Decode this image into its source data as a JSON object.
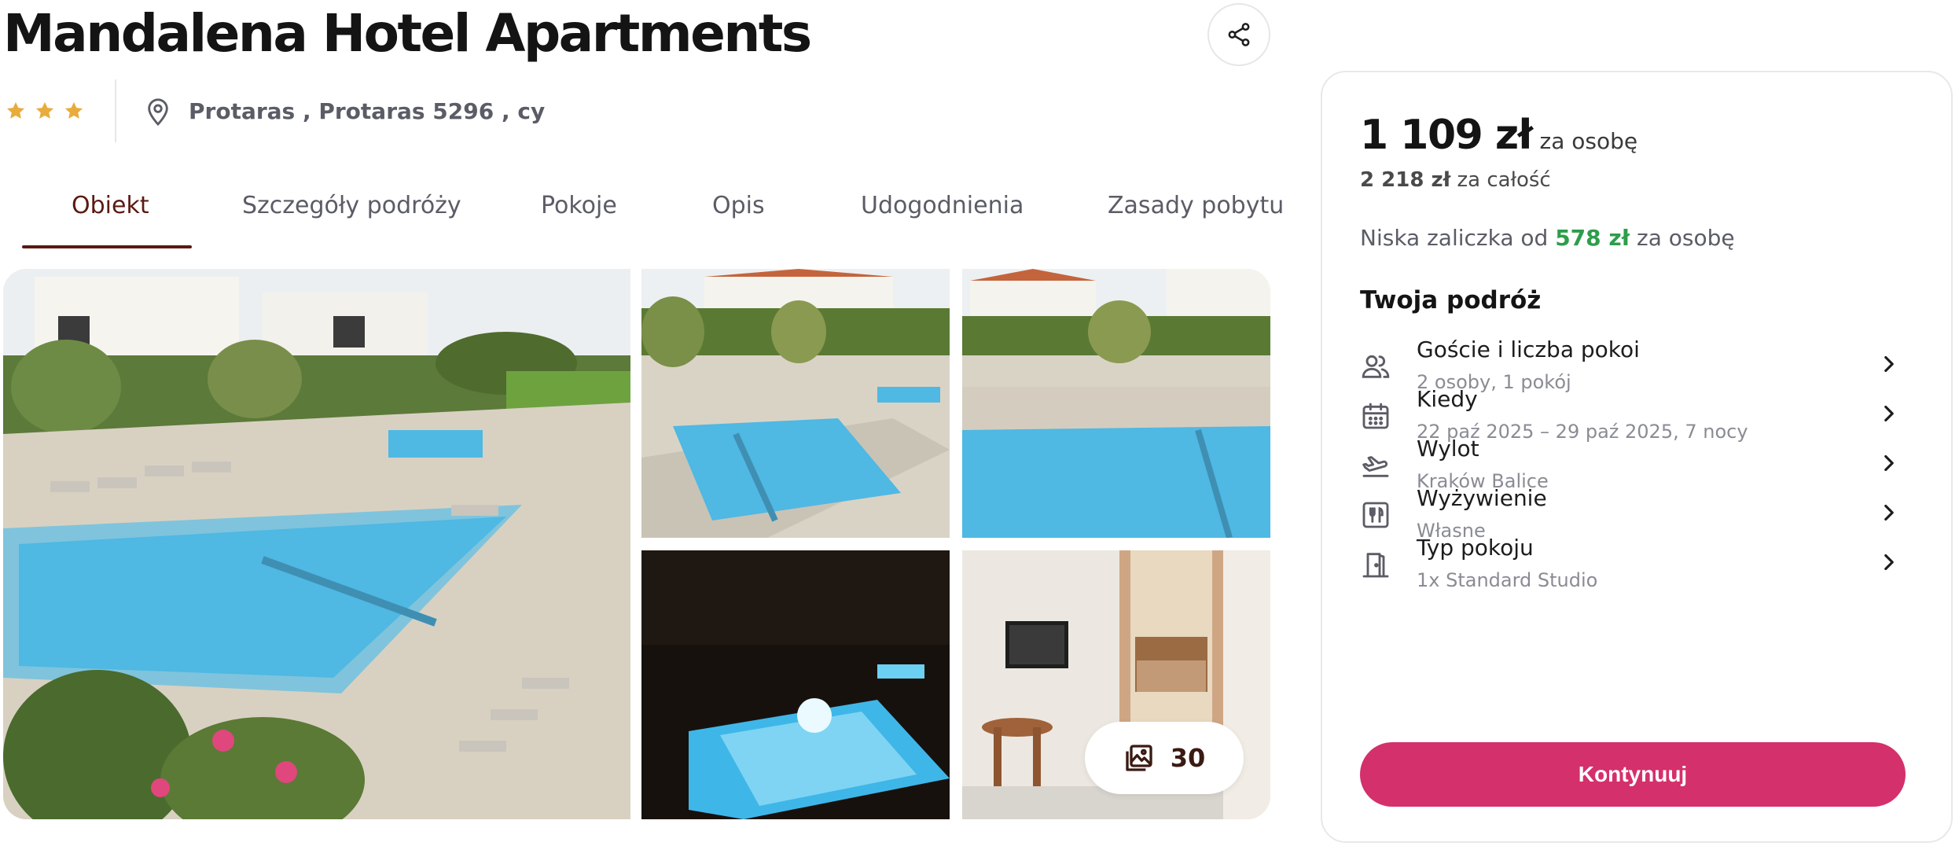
{
  "hotel": {
    "name": "Mandalena Hotel Apartments",
    "stars": 3,
    "location": "Protaras , Protaras 5296 , cy"
  },
  "tabs": [
    {
      "label": "Obiekt",
      "active": true
    },
    {
      "label": "Szczegóły podróży",
      "active": false
    },
    {
      "label": "Pokoje",
      "active": false
    },
    {
      "label": "Opis",
      "active": false
    },
    {
      "label": "Udogodnienia",
      "active": false
    },
    {
      "label": "Zasady pobytu",
      "active": false
    }
  ],
  "gallery": {
    "photo_count": "30"
  },
  "booking": {
    "price": "1 109 zł",
    "price_unit": "za osobę",
    "total_price": "2 218 zł",
    "total_unit": "za całość",
    "deposit_prefix": "Niska zaliczka od",
    "deposit_amount": "578 zł",
    "deposit_unit": "za osobę",
    "trip_heading": "Twoja podróż",
    "rows": [
      {
        "title": "Goście i liczba pokoi",
        "value": "2 osoby, 1 pokój",
        "icon": "guests-icon"
      },
      {
        "title": "Kiedy",
        "value": "22 paź 2025 – 29 paź 2025, 7 nocy",
        "icon": "calendar-icon"
      },
      {
        "title": "Wylot",
        "value": "Kraków Balice",
        "icon": "plane-departure-icon"
      },
      {
        "title": "Wyżywienie",
        "value": "Własne",
        "icon": "meal-icon"
      },
      {
        "title": "Typ pokoju",
        "value": "1x Standard Studio",
        "icon": "door-icon"
      }
    ],
    "continue_label": "Kontynuuj"
  },
  "colors": {
    "accent": "#d4306b",
    "active_tab": "#5b1a12",
    "star": "#e8ac3c",
    "deposit": "#2e9d4c",
    "pool": "#4fb8e3"
  }
}
